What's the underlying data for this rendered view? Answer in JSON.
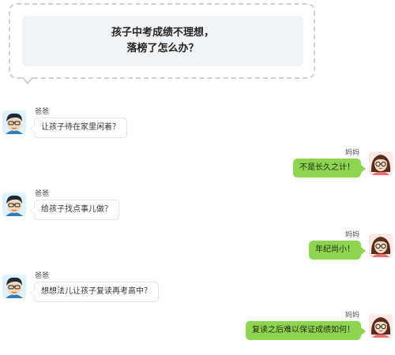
{
  "header": {
    "line1": "孩子中考成绩不理想，",
    "line2": "落榜了怎么办？"
  },
  "messages": [
    {
      "side": "left",
      "sender": "爸爸",
      "text": "让孩子待在家里闲着？",
      "avatar": "dad-avatar-icon"
    },
    {
      "side": "right",
      "sender": "妈妈",
      "text": "不是长久之计！",
      "avatar": "mom-avatar-icon"
    },
    {
      "side": "left",
      "sender": "爸爸",
      "text": "给孩子找点事儿做？",
      "avatar": "dad-avatar-icon"
    },
    {
      "side": "right",
      "sender": "妈妈",
      "text": "年纪尚小！",
      "avatar": "mom-avatar-icon"
    },
    {
      "side": "left",
      "sender": "爸爸",
      "text": "想想法儿让孩子复读再考高中？",
      "avatar": "dad-avatar-icon"
    },
    {
      "side": "right",
      "sender": "妈妈",
      "text": "复读之后难以保证成绩如何！",
      "avatar": "mom-avatar-icon"
    }
  ],
  "colors": {
    "right_bubble": "#8fd450",
    "left_bubble": "#ffffff",
    "card_bg": "#f2f3f5",
    "card_border": "#cfcfcf"
  }
}
